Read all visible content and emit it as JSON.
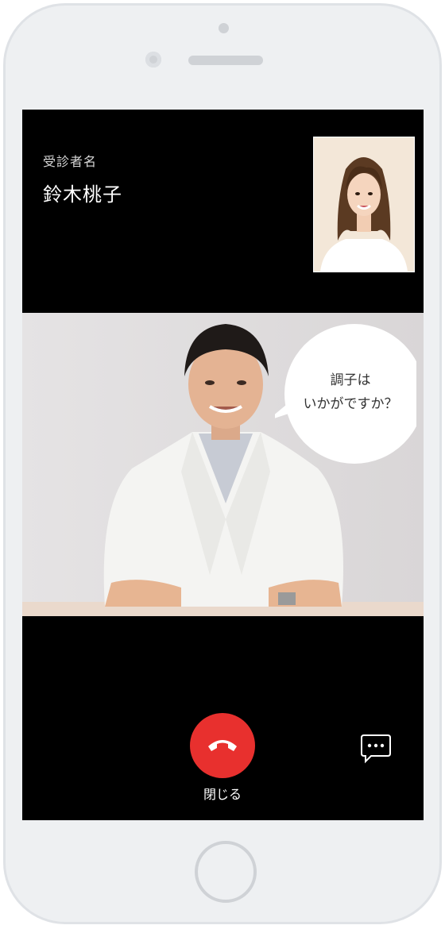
{
  "call": {
    "patient_label": "受診者名",
    "patient_name": "鈴木桃子",
    "speech_bubble": {
      "line1": "調子は",
      "line2": "いかがですか？"
    },
    "end_call_label": "閉じる"
  },
  "icons": {
    "end_call": "phone-hangup-icon",
    "chat": "chat-bubble-icon"
  },
  "colors": {
    "end_call": "#e8302e",
    "screen_background": "#000000",
    "device_frame": "#eef0f2"
  }
}
